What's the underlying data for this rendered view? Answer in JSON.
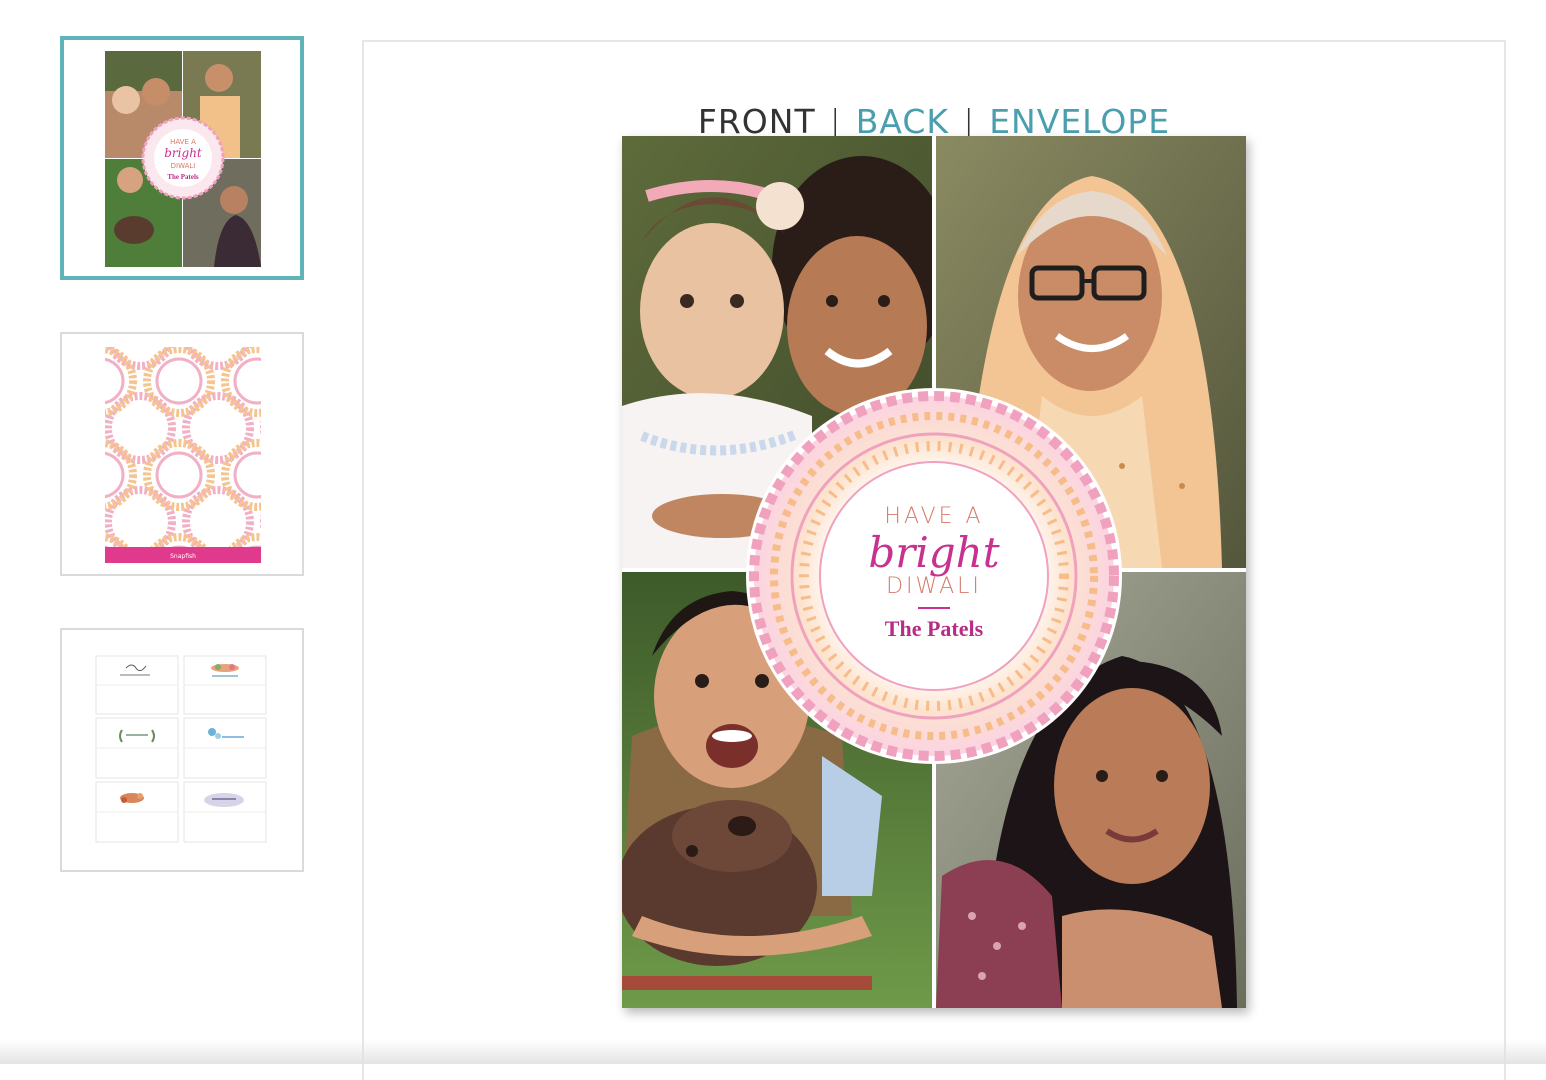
{
  "tabs": [
    {
      "label": "FRONT",
      "active": true
    },
    {
      "label": "BACK",
      "active": false
    },
    {
      "label": "ENVELOPE",
      "active": false
    }
  ],
  "thumbnails": [
    {
      "view": "front",
      "selected": true
    },
    {
      "view": "back",
      "selected": false
    },
    {
      "view": "envelope",
      "selected": false
    }
  ],
  "card": {
    "line1": "HAVE A",
    "line2": "bright",
    "line3": "DIWALI",
    "family_name": "The Patels"
  },
  "thumb_front": {
    "line1": "HAVE A",
    "line2": "bright",
    "line3": "DIWALI",
    "family_name": "The Patels"
  },
  "thumb_back": {
    "brand": "Snapfish"
  },
  "colors": {
    "accent_teal": "#5fb3b9",
    "tab_link": "#4a9faf",
    "tab_active": "#333333",
    "card_pink": "#c7318f",
    "card_coral": "#d67a6a",
    "back_band": "#e03a8c"
  }
}
